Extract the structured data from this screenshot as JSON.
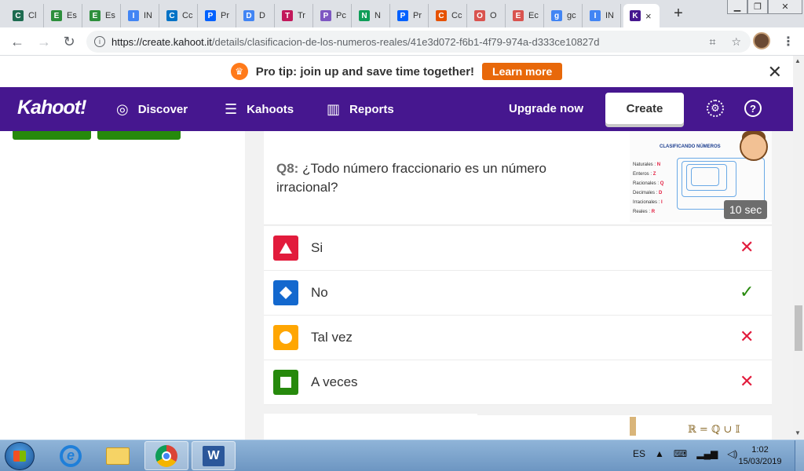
{
  "browser": {
    "tabs": [
      {
        "label": "Cl",
        "icon": "classroom-icon",
        "color": "#1e6b50"
      },
      {
        "label": "Es",
        "icon": "edmodo-icon",
        "color": "#2d8f3c"
      },
      {
        "label": "Es",
        "icon": "edmodo-icon",
        "color": "#2d8f3c"
      },
      {
        "label": "IN",
        "icon": "google-icon",
        "color": "#4285f4"
      },
      {
        "label": "Cc",
        "icon": "outlook-icon",
        "color": "#0072c6"
      },
      {
        "label": "Pr",
        "icon": "dropbox-icon",
        "color": "#0061fe"
      },
      {
        "label": "D",
        "icon": "docs-icon",
        "color": "#4285f4"
      },
      {
        "label": "Tr",
        "icon": "contacts-icon",
        "color": "#c2185b"
      },
      {
        "label": "Pc",
        "icon": "stripes-icon",
        "color": "#7e57c2"
      },
      {
        "label": "N",
        "icon": "drive-icon",
        "color": "#0f9d58"
      },
      {
        "label": "Pr",
        "icon": "dropbox-icon",
        "color": "#0061fe"
      },
      {
        "label": "Cc",
        "icon": "mm-icon",
        "color": "#e65100"
      },
      {
        "label": "O",
        "icon": "s-icon",
        "color": "#d9534f"
      },
      {
        "label": "Ec",
        "icon": "s-icon",
        "color": "#d9534f"
      },
      {
        "label": "gc",
        "icon": "google-icon",
        "color": "#4285f4"
      },
      {
        "label": "IN",
        "icon": "google-icon",
        "color": "#4285f4"
      }
    ],
    "active_tab": {
      "icon": "kahoot-icon",
      "close": "×"
    },
    "new_tab": "+",
    "url_host": "https://create.kahoot.it",
    "url_path": "/details/clasificacion-de-los-numeros-reales/41e3d072-f6b1-4f79-974a-d333ce10827d"
  },
  "banner": {
    "text": "Pro tip: join up and save time together!",
    "cta": "Learn more"
  },
  "nav": {
    "logo": "Kahoot!",
    "discover": "Discover",
    "kahoots": "Kahoots",
    "reports": "Reports",
    "upgrade": "Upgrade now",
    "create": "Create",
    "brand_color": "#46178f"
  },
  "question": {
    "number": "Q8:",
    "text": "¿Todo número fraccionario es un número irracional?",
    "time": "10 sec",
    "image": {
      "title": "CLASIFICANDO NÚMEROS",
      "rows": [
        {
          "label": "Naturales :",
          "symbol": "N"
        },
        {
          "label": "Enteros :",
          "symbol": "Z"
        },
        {
          "label": "Racionales :",
          "symbol": "Q"
        },
        {
          "label": "Decimales :",
          "symbol": "D"
        },
        {
          "label": "Irracionales :",
          "symbol": "I"
        },
        {
          "label": "Reales :",
          "symbol": "R"
        }
      ]
    }
  },
  "answers": [
    {
      "label": "Si",
      "shape": "triangle",
      "color": "#e21b3c",
      "correct": false
    },
    {
      "label": "No",
      "shape": "diamond",
      "color": "#1368ce",
      "correct": true
    },
    {
      "label": "Tal vez",
      "shape": "circle",
      "color": "#ffa602",
      "correct": false
    },
    {
      "label": "A veces",
      "shape": "square",
      "color": "#26890c",
      "correct": false
    }
  ],
  "next_card": {
    "formula": "ℝ = ℚ ∪ 𝕀"
  },
  "taskbar": {
    "language": "ES",
    "time": "1:02",
    "date": "15/03/2019"
  }
}
